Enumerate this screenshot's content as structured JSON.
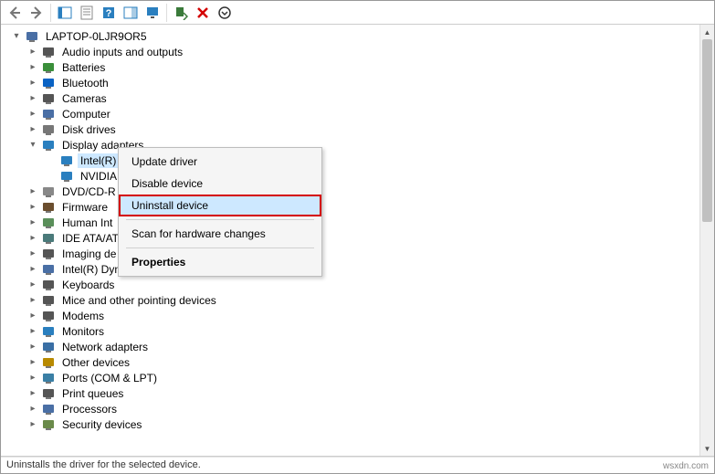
{
  "toolbar": {
    "back": "back-icon",
    "forward": "forward-icon",
    "show_hidden": "show-hidden",
    "properties": "properties",
    "help": "help",
    "view": "view",
    "monitor": "monitor",
    "scan": "scan",
    "remove": "remove",
    "more": "more"
  },
  "context_menu": {
    "update": "Update driver",
    "disable": "Disable device",
    "uninstall": "Uninstall device",
    "scan": "Scan for hardware changes",
    "properties": "Properties"
  },
  "tree": {
    "root": "LAPTOP-0LJR9OR5",
    "categories": [
      {
        "label": "Audio inputs and outputs",
        "exp": "closed",
        "icon": "audio"
      },
      {
        "label": "Batteries",
        "exp": "closed",
        "icon": "battery"
      },
      {
        "label": "Bluetooth",
        "exp": "closed",
        "icon": "bluetooth"
      },
      {
        "label": "Cameras",
        "exp": "closed",
        "icon": "camera"
      },
      {
        "label": "Computer",
        "exp": "closed",
        "icon": "computer"
      },
      {
        "label": "Disk drives",
        "exp": "closed",
        "icon": "disk"
      },
      {
        "label": "Display adapters",
        "exp": "open",
        "icon": "display",
        "children": [
          {
            "label": "Intel(R)",
            "icon": "display",
            "selected": true
          },
          {
            "label": "NVIDIA",
            "icon": "display"
          }
        ]
      },
      {
        "label": "DVD/CD-R",
        "exp": "closed",
        "icon": "dvd"
      },
      {
        "label": "Firmware",
        "exp": "closed",
        "icon": "firmware"
      },
      {
        "label": "Human Int",
        "exp": "closed",
        "icon": "hid"
      },
      {
        "label": "IDE ATA/AT",
        "exp": "closed",
        "icon": "ide"
      },
      {
        "label": "Imaging de",
        "exp": "closed",
        "icon": "imaging"
      },
      {
        "label": "Intel(R) Dynamic Platform and Thermal Framework",
        "exp": "closed",
        "icon": "chip"
      },
      {
        "label": "Keyboards",
        "exp": "closed",
        "icon": "keyboard"
      },
      {
        "label": "Mice and other pointing devices",
        "exp": "closed",
        "icon": "mouse"
      },
      {
        "label": "Modems",
        "exp": "closed",
        "icon": "modem"
      },
      {
        "label": "Monitors",
        "exp": "closed",
        "icon": "monitor"
      },
      {
        "label": "Network adapters",
        "exp": "closed",
        "icon": "network"
      },
      {
        "label": "Other devices",
        "exp": "closed",
        "icon": "other"
      },
      {
        "label": "Ports (COM & LPT)",
        "exp": "closed",
        "icon": "port"
      },
      {
        "label": "Print queues",
        "exp": "closed",
        "icon": "printer"
      },
      {
        "label": "Processors",
        "exp": "closed",
        "icon": "cpu"
      },
      {
        "label": "Security devices",
        "exp": "closed",
        "icon": "security"
      }
    ]
  },
  "status_text": "Uninstalls the driver for the selected device.",
  "attribution": "wsxdn.com",
  "icon_colors": {
    "audio": "#555",
    "battery": "#3a8f3a",
    "bluetooth": "#0a63c4",
    "camera": "#555",
    "computer": "#4a6fa5",
    "disk": "#777",
    "display": "#2a7fbf",
    "dvd": "#888",
    "firmware": "#6b4e2e",
    "hid": "#5a8f5a",
    "ide": "#4a7a7a",
    "imaging": "#555",
    "chip": "#4a6fa5",
    "keyboard": "#555",
    "mouse": "#555",
    "modem": "#555",
    "monitor": "#2a7fbf",
    "network": "#3a6fa5",
    "other": "#b88a00",
    "port": "#3a7fa5",
    "printer": "#555",
    "cpu": "#4a6fa5",
    "security": "#6a8a4a",
    "root": "#4a6fa5"
  }
}
